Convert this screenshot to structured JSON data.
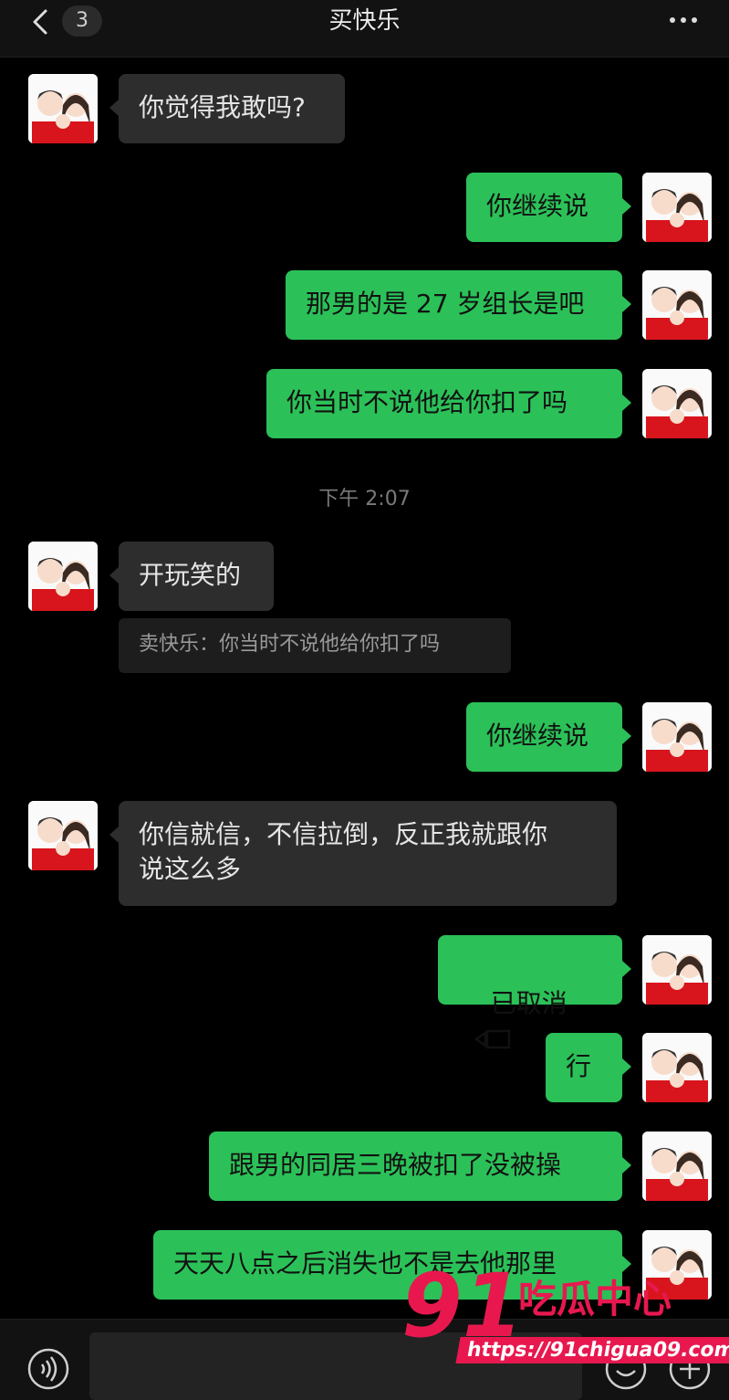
{
  "header": {
    "unread_count": "3",
    "title": "买快乐"
  },
  "messages": [
    {
      "dir": "in",
      "text": "你觉得我敢吗?"
    },
    {
      "dir": "out",
      "text": "你继续说"
    },
    {
      "dir": "out",
      "text": "那男的是 27 岁组长是吧"
    },
    {
      "dir": "out",
      "text": "你当时不说他给你扣了吗"
    },
    {
      "dir": "in",
      "text": "开玩笑的"
    },
    {
      "dir": "out",
      "text": "你继续说"
    },
    {
      "dir": "in",
      "text": "你信就信，不信拉倒，反正我就跟你\n说这么多"
    },
    {
      "dir": "out",
      "text": "已取消"
    },
    {
      "dir": "out",
      "text": "行"
    },
    {
      "dir": "out",
      "text": "跟男的同居三晚被扣了没被操"
    },
    {
      "dir": "out",
      "text": "天天八点之后消失也不是去他那里"
    }
  ],
  "timestamp": "下午 2:07",
  "quote": "卖快乐：你当时不说他给你扣了吗",
  "icons": {
    "back": "chevron-left-icon",
    "more": "more-dots-icon",
    "voice": "voice-icon",
    "emoji": "emoji-icon",
    "plus": "plus-icon",
    "call": "video-call-icon"
  },
  "colors": {
    "outgoing_bubble": "#2bc158",
    "incoming_bubble": "#2d2d2d",
    "background": "#000000",
    "watermark": "#e8184f"
  },
  "watermark": {
    "number": "91",
    "brand": "吃瓜中心",
    "url": "https://91chigua09.com"
  }
}
